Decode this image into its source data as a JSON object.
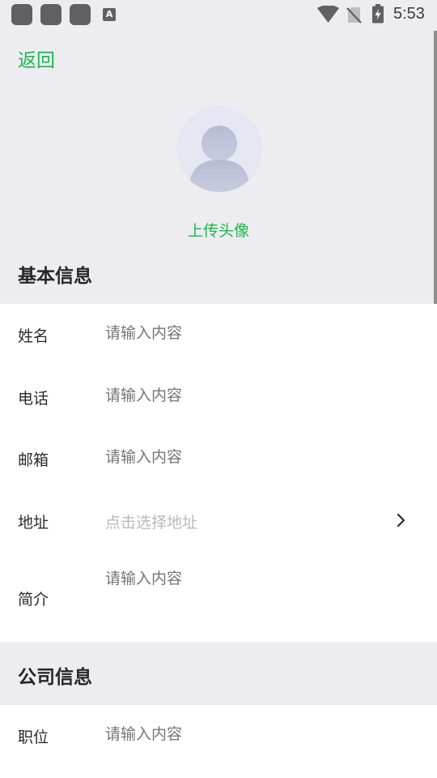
{
  "status_bar": {
    "time": "5:53",
    "a_badge": "A",
    "icons": [
      "notification-icon",
      "notification-icon",
      "notification-icon",
      "a-icon",
      "wifi-icon",
      "no-sim-icon",
      "battery-icon"
    ]
  },
  "header": {
    "back_label": "返回"
  },
  "avatar": {
    "upload_label": "上传头像",
    "icon": "user-avatar-icon"
  },
  "basic_info": {
    "title": "基本信息",
    "fields": [
      {
        "label": "姓名",
        "placeholder": "请输入内容"
      },
      {
        "label": "电话",
        "placeholder": "请输入内容"
      },
      {
        "label": "邮箱",
        "placeholder": "请输入内容"
      },
      {
        "label": "地址",
        "placeholder": "点击选择地址",
        "icon": "chevron-right-icon"
      },
      {
        "label": "简介",
        "placeholder": "请输入内容"
      }
    ]
  },
  "company_info": {
    "title": "公司信息",
    "fields": [
      {
        "label": "职位",
        "placeholder": "请输入内容"
      }
    ]
  },
  "colors": {
    "accent": "#1bb84a",
    "background": "#edecf1",
    "card": "#ffffff",
    "placeholder": "#b9b9bd"
  }
}
